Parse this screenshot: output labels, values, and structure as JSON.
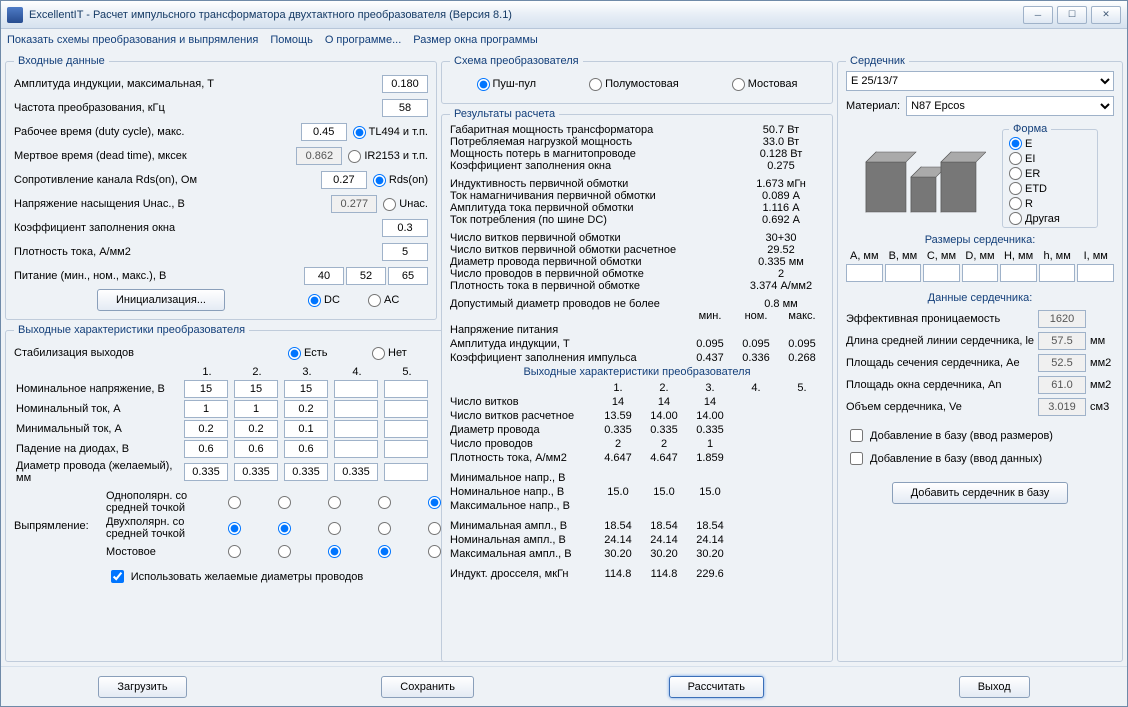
{
  "title": "ExcellentIT - Расчет импульсного трансформатора двухтактного преобразователя (Версия 8.1)",
  "menu": [
    "Показать схемы преобразования и выпрямления",
    "Помощь",
    "О программе...",
    "Размер окна программы"
  ],
  "input": {
    "legend": "Входные данные",
    "amp": {
      "lbl": "Амплитуда индукции, максимальная, Т",
      "val": "0.180"
    },
    "freq": {
      "lbl": "Частота преобразования, кГц",
      "val": "58"
    },
    "duty": {
      "lbl": "Рабочее время (duty cycle), макс.",
      "val": "0.45",
      "opt": "TL494 и т.п."
    },
    "dead": {
      "lbl": "Мертвое время (dead time), мксек",
      "val": "0.862",
      "opt": "IR2153 и т.п."
    },
    "rds": {
      "lbl": "Сопротивление канала Rds(on), Ом",
      "val": "0.27",
      "opt": "Rds(on)"
    },
    "usat": {
      "lbl": "Напряжение насыщения Uнас., В",
      "val": "0.277",
      "opt": "Uнас."
    },
    "kfill": {
      "lbl": "Коэффициент заполнения окна",
      "val": "0.3"
    },
    "jcur": {
      "lbl": "Плотность тока, А/мм2",
      "val": "5"
    },
    "supply": {
      "lbl": "Питание (мин., ном., макс.), В",
      "v1": "40",
      "v2": "52",
      "v3": "65"
    },
    "init": "Инициализация...",
    "dc": "DC",
    "ac": "AC"
  },
  "outc": {
    "legend": "Выходные характеристики преобразователя",
    "stab": {
      "lbl": "Стабилизация выходов",
      "yes": "Есть",
      "no": "Нет"
    },
    "cols": [
      "1.",
      "2.",
      "3.",
      "4.",
      "5."
    ],
    "unom": {
      "lbl": "Номинальное напряжение, В",
      "v": [
        "15",
        "15",
        "15",
        "",
        ""
      ]
    },
    "inom": {
      "lbl": "Номинальный ток, А",
      "v": [
        "1",
        "1",
        "0.2",
        "",
        ""
      ]
    },
    "imin": {
      "lbl": "Минимальный ток, А",
      "v": [
        "0.2",
        "0.2",
        "0.1",
        "",
        ""
      ]
    },
    "dvdrop": {
      "lbl": "Падение на диодах, В",
      "v": [
        "0.6",
        "0.6",
        "0.6",
        "",
        ""
      ]
    },
    "dwire": {
      "lbl": "Диаметр провода (желаемый), мм",
      "v": [
        "0.335",
        "0.335",
        "0.335",
        "0.335",
        ""
      ]
    },
    "rect": {
      "lbl": "Выпрямление:",
      "r1": "Однополярн. со средней точкой",
      "r2": "Двухполярн. со средней точкой",
      "r3": "Мостовое"
    },
    "chkd": "Использовать желаемые диаметры проводов"
  },
  "scheme": {
    "legend": "Схема преобразователя",
    "o1": "Пуш-пул",
    "o2": "Полумостовая",
    "o3": "Мостовая"
  },
  "res": {
    "legend": "Результаты расчета",
    "rows": [
      {
        "n": "Габаритная мощность трансформатора",
        "v": "50.7 Вт"
      },
      {
        "n": "Потребляемая нагрузкой мощность",
        "v": "33.0 Вт"
      },
      {
        "n": "Мощность потерь в магнитопроводе",
        "v": "0.128 Вт"
      },
      {
        "n": "Коэффициент заполнения окна",
        "v": "0.275"
      },
      {
        "n": "",
        "v": ""
      },
      {
        "n": "Индуктивность первичной обмотки",
        "v": "1.673 мГн"
      },
      {
        "n": "Ток намагничивания первичной обмотки",
        "v": "0.089 А"
      },
      {
        "n": "Амплитуда тока первичной обмотки",
        "v": "1.116 А"
      },
      {
        "n": "Ток потребления (по шине DC)",
        "v": "0.692 А"
      },
      {
        "n": "",
        "v": ""
      },
      {
        "n": "Число витков первичной обмотки",
        "v": "30+30"
      },
      {
        "n": "Число витков первичной обмотки расчетное",
        "v": "29.52"
      },
      {
        "n": "Диаметр провода первичной обмотки",
        "v": "0.335 мм"
      },
      {
        "n": "Число проводов в первичной обмотке",
        "v": "2"
      },
      {
        "n": "Плотность тока в первичной обмотке",
        "v": "3.374 А/мм2"
      },
      {
        "n": "",
        "v": ""
      },
      {
        "n": "Допустимый диаметр проводов не более",
        "v": "0.8 мм"
      }
    ],
    "mnm": {
      "hdr": [
        "мин.",
        "ном.",
        "макс."
      ],
      "rows": [
        {
          "n": "Напряжение питания",
          "v": [
            "",
            "",
            ""
          ]
        },
        {
          "n": "Амплитуда индукции, Т",
          "v": [
            "0.095",
            "0.095",
            "0.095"
          ]
        },
        {
          "n": "Коэффициент заполнения импульса",
          "v": [
            "0.437",
            "0.336",
            "0.268"
          ]
        }
      ]
    },
    "outs": {
      "hdr": "Выходные характеристики преобразователя",
      "cols": [
        "1.",
        "2.",
        "3.",
        "4.",
        "5."
      ],
      "rows": [
        {
          "n": "Число витков",
          "v": [
            "14",
            "14",
            "14",
            "",
            ""
          ]
        },
        {
          "n": "Число витков расчетное",
          "v": [
            "13.59",
            "14.00",
            "14.00",
            "",
            ""
          ]
        },
        {
          "n": "Диаметр провода",
          "v": [
            "0.335",
            "0.335",
            "0.335",
            "",
            ""
          ]
        },
        {
          "n": "Число проводов",
          "v": [
            "2",
            "2",
            "1",
            "",
            ""
          ]
        },
        {
          "n": "Плотность тока, А/мм2",
          "v": [
            "4.647",
            "4.647",
            "1.859",
            "",
            ""
          ]
        },
        {
          "n": "",
          "v": [
            "",
            "",
            "",
            "",
            ""
          ]
        },
        {
          "n": "Минимальное напр., В",
          "v": [
            "",
            "",
            "",
            "",
            ""
          ]
        },
        {
          "n": "Номинальное напр., В",
          "v": [
            "15.0",
            "15.0",
            "15.0",
            "",
            ""
          ]
        },
        {
          "n": "Максимальное напр., В",
          "v": [
            "",
            "",
            "",
            "",
            ""
          ]
        },
        {
          "n": "",
          "v": [
            "",
            "",
            "",
            "",
            ""
          ]
        },
        {
          "n": "Минимальная ампл., В",
          "v": [
            "18.54",
            "18.54",
            "18.54",
            "",
            ""
          ]
        },
        {
          "n": "Номинальная ампл., В",
          "v": [
            "24.14",
            "24.14",
            "24.14",
            "",
            ""
          ]
        },
        {
          "n": "Максимальная ампл., В",
          "v": [
            "30.20",
            "30.20",
            "30.20",
            "",
            ""
          ]
        },
        {
          "n": "",
          "v": [
            "",
            "",
            "",
            "",
            ""
          ]
        },
        {
          "n": "Индукт. дросселя, мкГн",
          "v": [
            "114.8",
            "114.8",
            "229.6",
            "",
            ""
          ]
        }
      ]
    }
  },
  "core": {
    "legend": "Сердечник",
    "sel": "E 25/13/7",
    "matlbl": "Материал:",
    "mat": "N87 Epcos",
    "shapehdr": "Форма",
    "shapes": [
      "E",
      "EI",
      "ER",
      "ETD",
      "R",
      "Другая"
    ],
    "dimshdr": "Размеры сердечника:",
    "dims": [
      "A, мм",
      "B, мм",
      "C, мм",
      "D, мм",
      "H, мм",
      "h, мм",
      "I, мм"
    ],
    "datahdr": "Данные сердечника:",
    "data": [
      {
        "n": "Эффективная проницаемость",
        "v": "1620",
        "u": ""
      },
      {
        "n": "Длина средней линии сердечника, le",
        "v": "57.5",
        "u": "мм"
      },
      {
        "n": "Площадь сечения сердечника, Ae",
        "v": "52.5",
        "u": "мм2"
      },
      {
        "n": "Площадь окна сердечника, An",
        "v": "61.0",
        "u": "мм2"
      },
      {
        "n": "Объем сердечника, Ve",
        "v": "3.019",
        "u": "см3"
      }
    ],
    "chk1": "Добавление в базу (ввод размеров)",
    "chk2": "Добавление в базу (ввод данных)",
    "btn": "Добавить сердечник в базу"
  },
  "btm": {
    "load": "Загрузить",
    "save": "Сохранить",
    "calc": "Рассчитать",
    "exit": "Выход"
  }
}
